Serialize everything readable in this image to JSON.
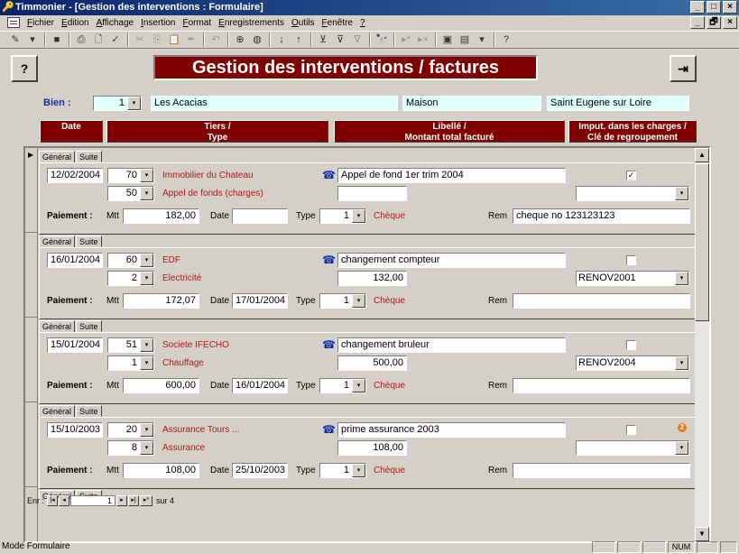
{
  "window": {
    "title": "Timmonier - [Gestion des interventions : Formulaire]",
    "min": "_",
    "max": "□",
    "close": "×",
    "mdi_min": "_",
    "mdi_restore": "🗗",
    "mdi_close": "×"
  },
  "menu": [
    {
      "key": "F",
      "rest": "ichier"
    },
    {
      "key": "E",
      "rest": "dition"
    },
    {
      "key": "A",
      "rest": "ffichage"
    },
    {
      "key": "I",
      "rest": "nsertion"
    },
    {
      "key": "F",
      "rest": "ormat"
    },
    {
      "key": "E",
      "rest": "nregistrements"
    },
    {
      "key": "O",
      "rest": "utils"
    },
    {
      "key": "F",
      "rest": "enêtre"
    },
    {
      "key": "?",
      "rest": ""
    }
  ],
  "toolbar": [
    {
      "icon": "design-view-icon",
      "glyph": "✎"
    },
    {
      "icon": "dropdown-icon",
      "glyph": "▾"
    },
    {
      "sep": true
    },
    {
      "icon": "save-icon",
      "glyph": "■"
    },
    {
      "sep": true
    },
    {
      "icon": "print-icon",
      "glyph": "⎙"
    },
    {
      "icon": "print-preview-icon",
      "glyph": "🗋"
    },
    {
      "icon": "spelling-icon",
      "glyph": "✓"
    },
    {
      "sep": true
    },
    {
      "icon": "cut-icon",
      "glyph": "✂",
      "dim": true
    },
    {
      "icon": "copy-icon",
      "glyph": "⎘",
      "dim": true
    },
    {
      "icon": "paste-icon",
      "glyph": "📋",
      "dim": true
    },
    {
      "icon": "format-painter-icon",
      "glyph": "✒",
      "dim": true
    },
    {
      "sep": true
    },
    {
      "icon": "undo-icon",
      "glyph": "↶",
      "dim": true
    },
    {
      "sep": true
    },
    {
      "icon": "hyperlink-icon",
      "glyph": "⊕"
    },
    {
      "icon": "web-icon",
      "glyph": "◍"
    },
    {
      "sep": true
    },
    {
      "icon": "sort-asc-icon",
      "glyph": "↓"
    },
    {
      "icon": "sort-desc-icon",
      "glyph": "↑"
    },
    {
      "sep": true
    },
    {
      "icon": "filter-selection-icon",
      "glyph": "⊻"
    },
    {
      "icon": "filter-form-icon",
      "glyph": "⊽"
    },
    {
      "icon": "apply-filter-icon",
      "glyph": "∇",
      "dim": true
    },
    {
      "sep": true
    },
    {
      "icon": "find-icon",
      "glyph": "🔭"
    },
    {
      "sep": true
    },
    {
      "icon": "new-record-icon",
      "glyph": "▸*",
      "dim": true
    },
    {
      "icon": "delete-record-icon",
      "glyph": "▸×",
      "dim": true
    },
    {
      "sep": true
    },
    {
      "icon": "database-window-icon",
      "glyph": "▣"
    },
    {
      "icon": "new-object-icon",
      "glyph": "▤"
    },
    {
      "icon": "dropdown-icon",
      "glyph": "▾"
    },
    {
      "sep": true
    },
    {
      "icon": "help-icon",
      "glyph": "?"
    }
  ],
  "form": {
    "title": "Gestion des interventions / factures",
    "help_glyph": "?",
    "exit_glyph": "⇥",
    "bien_label": "Bien :",
    "bien_value": "1",
    "bien_name": "Les Acacias",
    "bien_type": "Maison",
    "bien_city": "Saint Eugene sur Loire"
  },
  "columns": [
    "Date",
    "Tiers /\nType",
    "Libellé /\nMontant total facturé",
    "Imput. dans les charges /\nClé de regroupement"
  ],
  "tabs": [
    "Général",
    "Suite"
  ],
  "labels": {
    "paiement": "Paiement :",
    "mtt": "Mtt",
    "date": "Date",
    "type": "Type",
    "rem": "Rem"
  },
  "arrow": "▾",
  "records": [
    {
      "date": "12/02/2004",
      "tiers_id": "70",
      "tiers": "Immobilier du Chateau",
      "type_id": "50",
      "type": "Appel de fonds (charges)",
      "libelle": "Appel de fond 1er trim 2004",
      "montant": "",
      "imput_checked": "✓",
      "cle": "",
      "mtt": "182,00",
      "pay_date": "",
      "pay_type_id": "1",
      "pay_type": "Chèque",
      "rem": "cheque no 123123123"
    },
    {
      "date": "16/01/2004",
      "tiers_id": "60",
      "tiers": "EDF",
      "type_id": "2",
      "type": "Electricité",
      "libelle": "changement compteur",
      "montant": "132,00",
      "imput_checked": "",
      "cle": "RENOV2001",
      "mtt": "172,07",
      "pay_date": "17/01/2004",
      "pay_type_id": "1",
      "pay_type": "Chèque",
      "rem": ""
    },
    {
      "date": "15/01/2004",
      "tiers_id": "51",
      "tiers": "Societe IFECHO",
      "type_id": "1",
      "type": "Chauffage",
      "libelle": "changement bruleur",
      "montant": "500,00",
      "imput_checked": "",
      "cle": "RENOV2004",
      "mtt": "600,00",
      "pay_date": "16/01/2004",
      "pay_type_id": "1",
      "pay_type": "Chèque",
      "rem": ""
    },
    {
      "date": "15/10/2003",
      "tiers_id": "20",
      "tiers": "Assurance Tours ...",
      "type_id": "8",
      "type": "Assurance",
      "libelle": "prime assurance 2003",
      "montant": "108,00",
      "imput_checked": "",
      "cle": "",
      "badge": "2",
      "mtt": "108,00",
      "pay_date": "25/10/2003",
      "pay_type_id": "1",
      "pay_type": "Chèque",
      "rem": ""
    }
  ],
  "navigation": {
    "label": "Enr :",
    "first": "|◂",
    "prev": "◂",
    "current": "1",
    "next": "▸",
    "last": "▸|",
    "new": "▸*",
    "total_label": "sur 4"
  },
  "status": {
    "text": "Mode Formulaire",
    "num": "NUM"
  }
}
